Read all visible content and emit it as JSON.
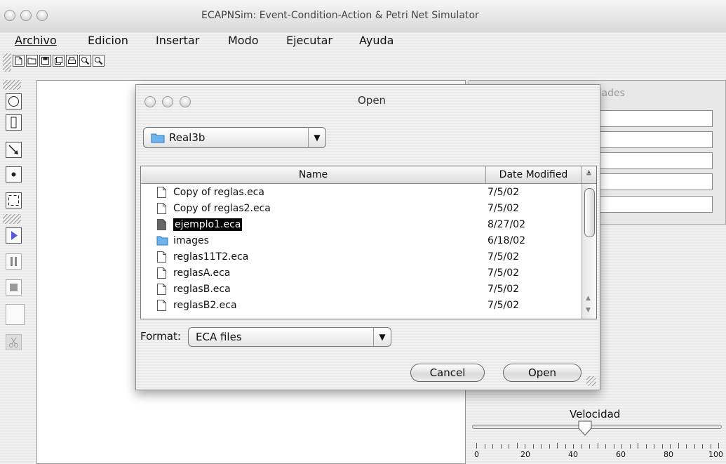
{
  "app": {
    "title": "ECAPNSim: Event-Condition-Action & Petri Net Simulator"
  },
  "menubar": [
    "Archivo",
    "Edicion",
    "Insertar",
    "Modo",
    "Ejecutar",
    "Ayuda"
  ],
  "toolbar": {
    "icons": [
      "new-icon",
      "open-icon",
      "save-icon",
      "save-as-icon",
      "print-icon",
      "zoom-in-icon",
      "zoom-out-icon"
    ]
  },
  "palette": {
    "tools": [
      "place-tool-icon",
      "transition-tool-icon",
      "arc-tool-icon",
      "token-tool-icon",
      "select-tool-icon"
    ],
    "controls": [
      "play-icon",
      "pause-icon",
      "stop-icon",
      "blank-control",
      "cut-icon"
    ]
  },
  "properties": {
    "title": "Propiedades"
  },
  "dialog": {
    "title": "Open",
    "folder": "Real3b",
    "columns": {
      "name": "Name",
      "date": "Date Modified"
    },
    "files": [
      {
        "name": "Copy of reglas.eca",
        "date": "7/5/02",
        "kind": "file"
      },
      {
        "name": "Copy of reglas2.eca",
        "date": "7/5/02",
        "kind": "file"
      },
      {
        "name": "ejemplo1.eca",
        "date": "8/27/02",
        "kind": "file",
        "selected": true
      },
      {
        "name": "images",
        "date": "6/18/02",
        "kind": "folder"
      },
      {
        "name": "reglas11T2.eca",
        "date": "7/5/02",
        "kind": "file"
      },
      {
        "name": "reglasA.eca",
        "date": "7/5/02",
        "kind": "file"
      },
      {
        "name": "reglasB.eca",
        "date": "7/5/02",
        "kind": "file"
      },
      {
        "name": "reglasB2.eca",
        "date": "7/5/02",
        "kind": "file"
      }
    ],
    "format_label": "Format:",
    "format_value": "ECA files",
    "cancel_label": "Cancel",
    "open_label": "Open"
  },
  "speed": {
    "label": "Velocidad",
    "value": 45,
    "ticks": [
      "0",
      "20",
      "40",
      "60",
      "80",
      "100"
    ]
  },
  "colors": {
    "selection": "#000000",
    "folder": "#5aa6e6"
  }
}
